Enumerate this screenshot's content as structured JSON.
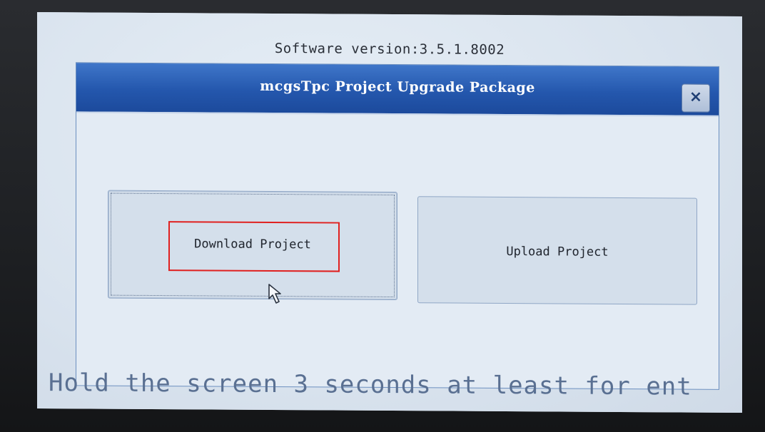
{
  "screen": {
    "version_text": "Software version:3.5.1.8002"
  },
  "dialog": {
    "title": "mcgsTpc Project Upgrade Package",
    "close_label": "×",
    "buttons": {
      "download_label": "Download Project",
      "upload_label": "Upload Project"
    }
  },
  "ticker": {
    "text": "Hold the screen 3 seconds at least for ent"
  },
  "icons": {
    "close": "close-icon",
    "cursor": "cursor-arrow-icon"
  },
  "colors": {
    "titlebar": "#2457ad",
    "highlight": "#e0201f",
    "screen_bg": "#dde6ef"
  }
}
